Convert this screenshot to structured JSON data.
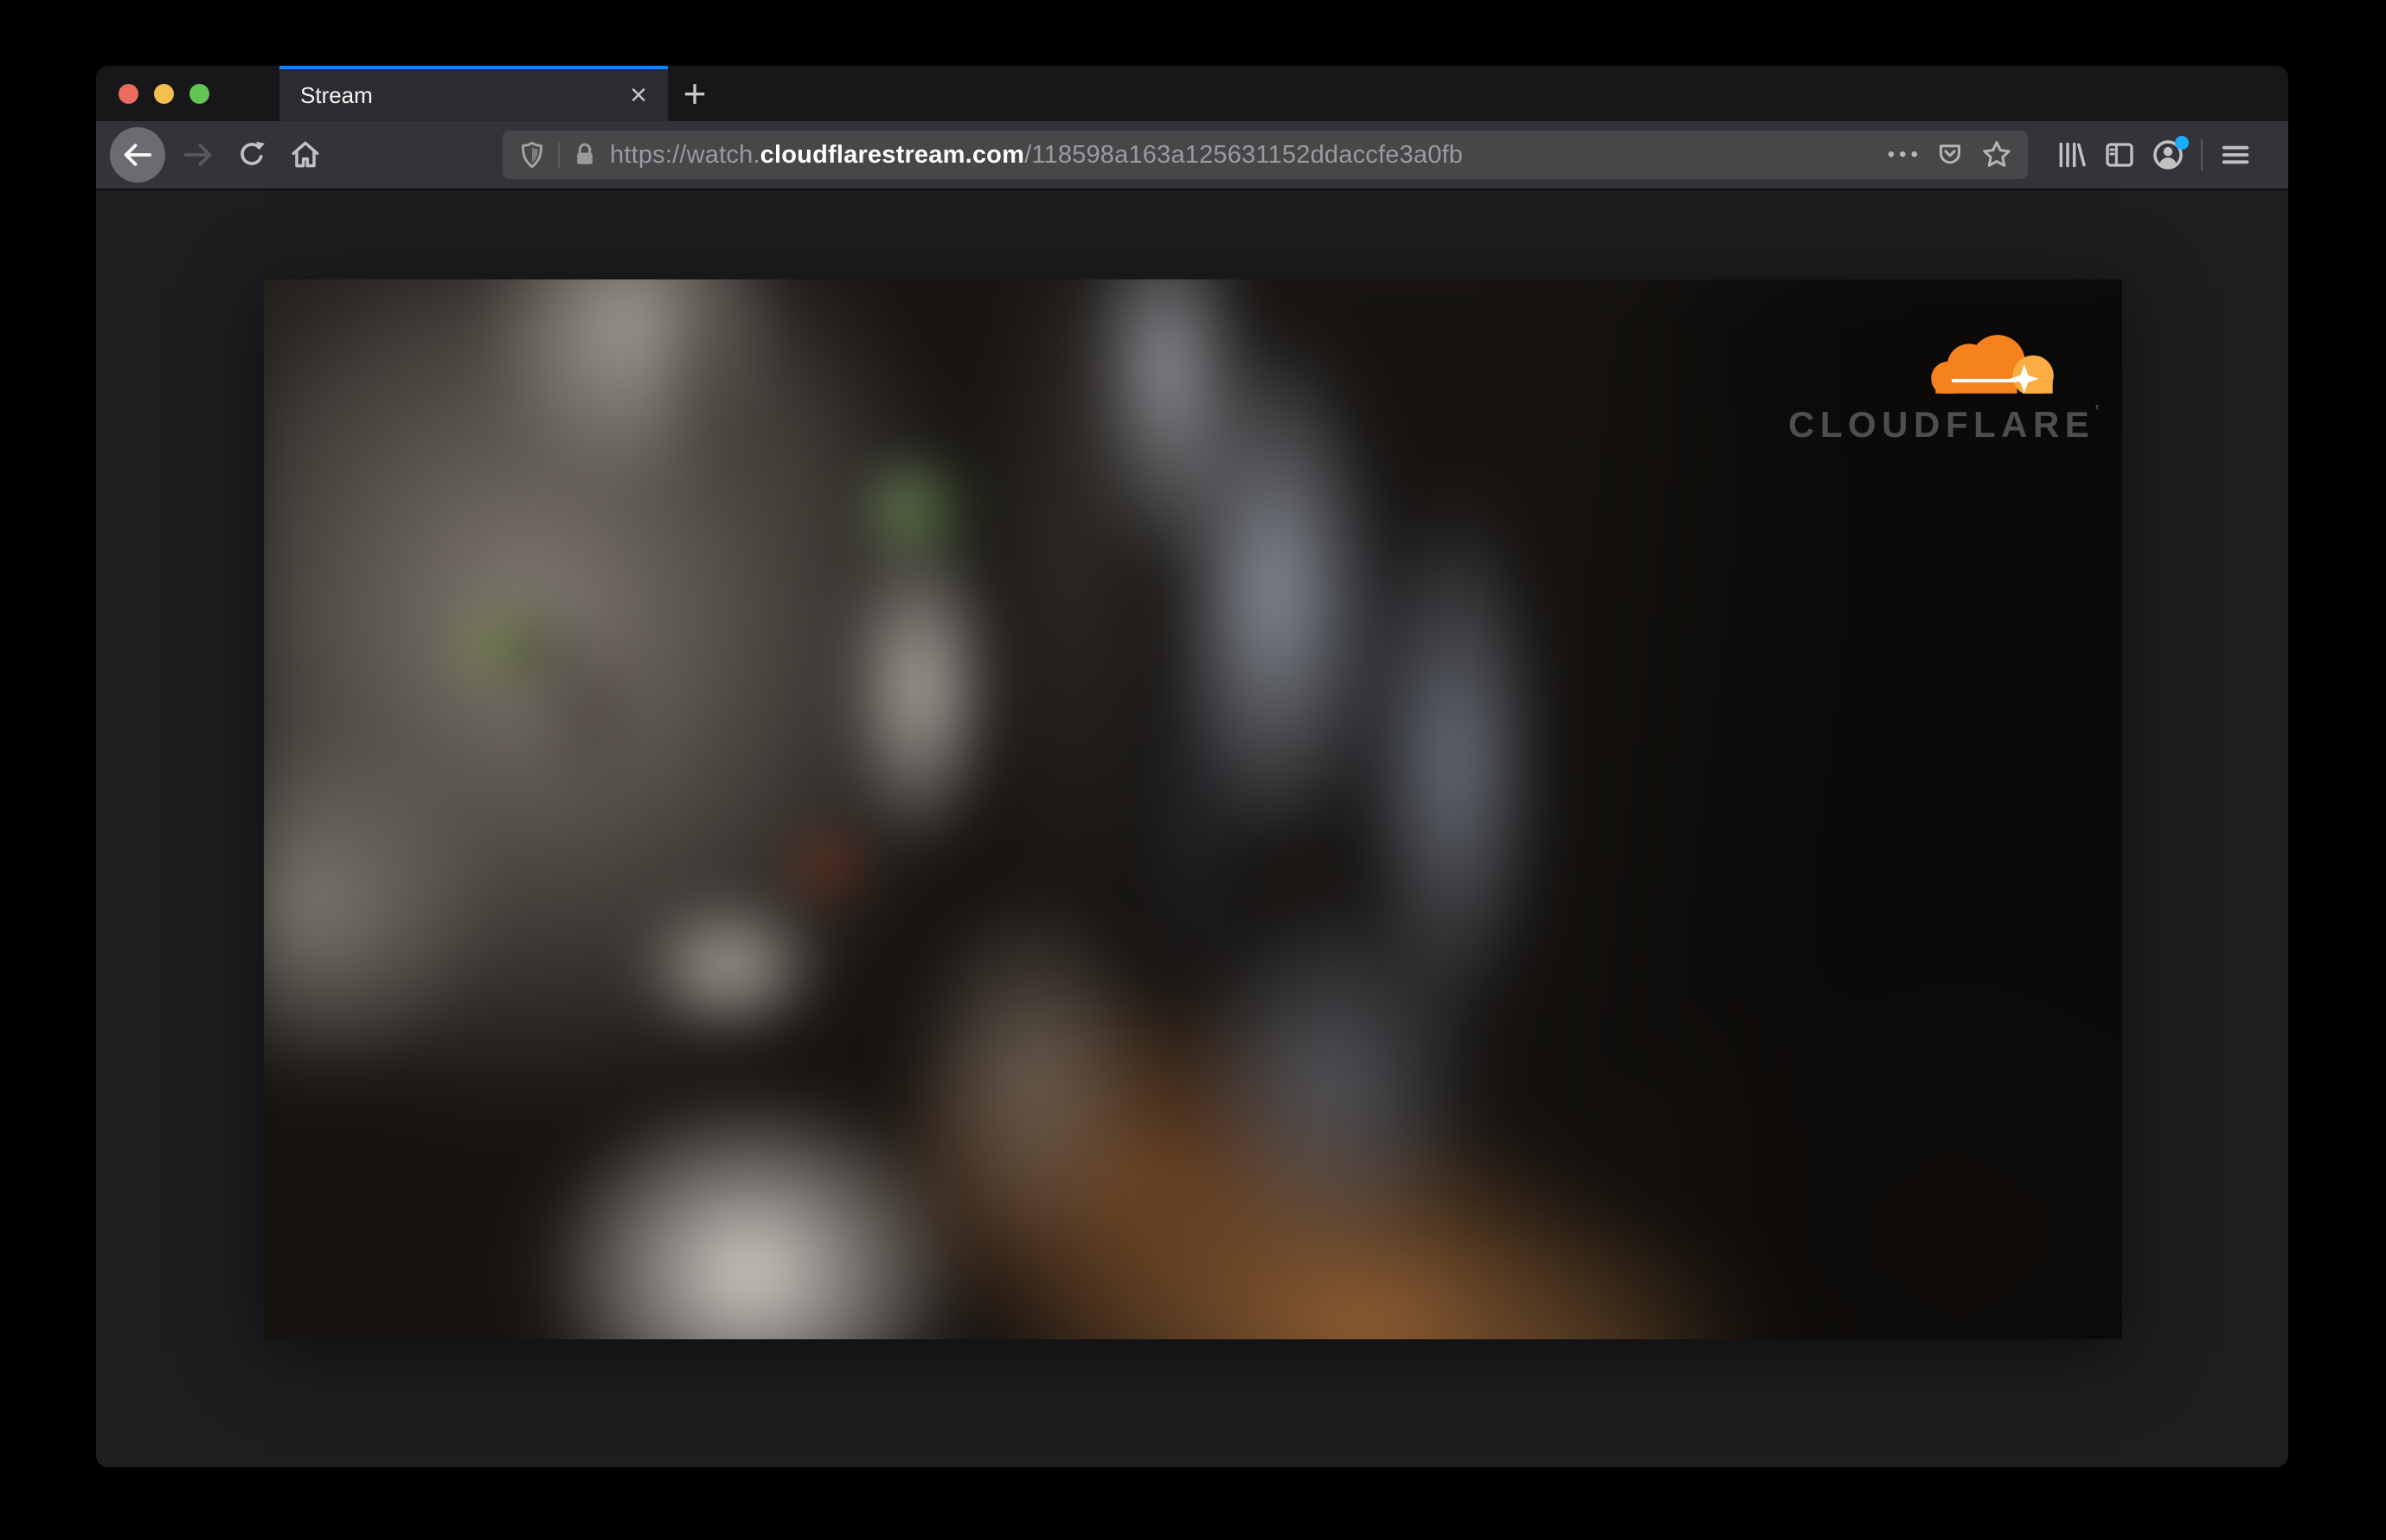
{
  "window": {
    "traffic_lights": [
      {
        "name": "close",
        "color": "#ed6a5f"
      },
      {
        "name": "minimize",
        "color": "#f5bf4f"
      },
      {
        "name": "zoom",
        "color": "#62c554"
      }
    ]
  },
  "tab_bar": {
    "active_tab": {
      "title": "Stream",
      "close_glyph": "×"
    },
    "new_tab_glyph": "+"
  },
  "toolbar": {
    "url_bar": {
      "scheme": "https://watch.",
      "domain": "cloudflarestream.com",
      "path": "/118598a163a125631152ddaccfe3a0fb",
      "page_actions_glyph": "•••"
    }
  },
  "page": {
    "video_overlay": {
      "brand_text": "CLOUDFLARE",
      "trademark_glyph": "’"
    }
  },
  "icons": {
    "back-icon": "left arrow in light circle",
    "forward-icon": "right arrow (disabled)",
    "reload-icon": "circular arrow ↻",
    "home-icon": "house ⌂",
    "shield-icon": "tracking-protection shield",
    "lock-icon": "padlock 🔒",
    "page-actions-icon": "•••",
    "pocket-icon": "pocket with chevron",
    "bookmark-star-icon": "☆",
    "library-icon": "three books with leaning book",
    "sidebar-icon": "panel rectangle",
    "account-icon": "person in circle",
    "menu-icon": "≡",
    "close-tab-icon": "×",
    "new-tab-icon": "+",
    "cloudflare-cloud-icon": "orange cloud with sparkle"
  },
  "colors": {
    "accent_blue": "#0a84ff",
    "notification_blue": "#19aeff",
    "cloudflare_orange": "#f6821f",
    "cloudflare_light_orange": "#fbad41",
    "toolbar_bg": "#333338",
    "titlebar_bg": "#17171a",
    "urlbar_bg": "#47474a",
    "page_bg": "#1e1e21",
    "cat_eye_green": "#82b95f",
    "cat_nose_rust": "#aa3e1c"
  }
}
